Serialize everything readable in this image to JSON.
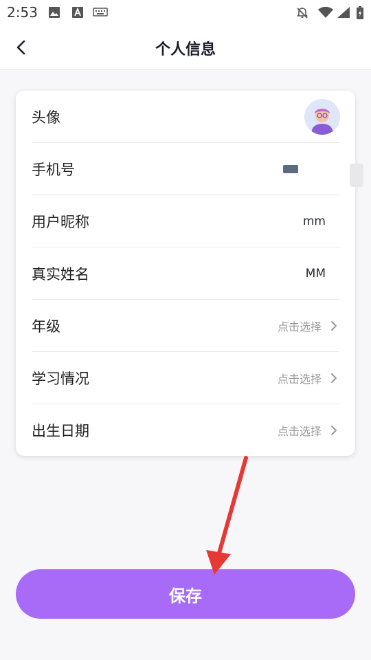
{
  "status_bar": {
    "time": "2:53"
  },
  "header": {
    "title": "个人信息"
  },
  "profile": {
    "rows": [
      {
        "label": "头像"
      },
      {
        "label": "手机号"
      },
      {
        "label": "用户昵称",
        "value": "mm"
      },
      {
        "label": "真实姓名",
        "value": "MM"
      },
      {
        "label": "年级",
        "hint": "点击选择"
      },
      {
        "label": "学习情况",
        "hint": "点击选择"
      },
      {
        "label": "出生日期",
        "hint": "点击选择"
      }
    ]
  },
  "save_button": {
    "label": "保存"
  },
  "colors": {
    "accent": "#a86bf7",
    "annotation_arrow": "#e53935",
    "background": "#f7f6f8"
  },
  "icons": [
    "image-icon",
    "a-badge-icon",
    "keyboard-icon",
    "bell-off-icon",
    "wifi-icon",
    "signal-icon",
    "battery-icon",
    "back-arrow-icon",
    "chevron-right-icon",
    "avatar-image"
  ]
}
